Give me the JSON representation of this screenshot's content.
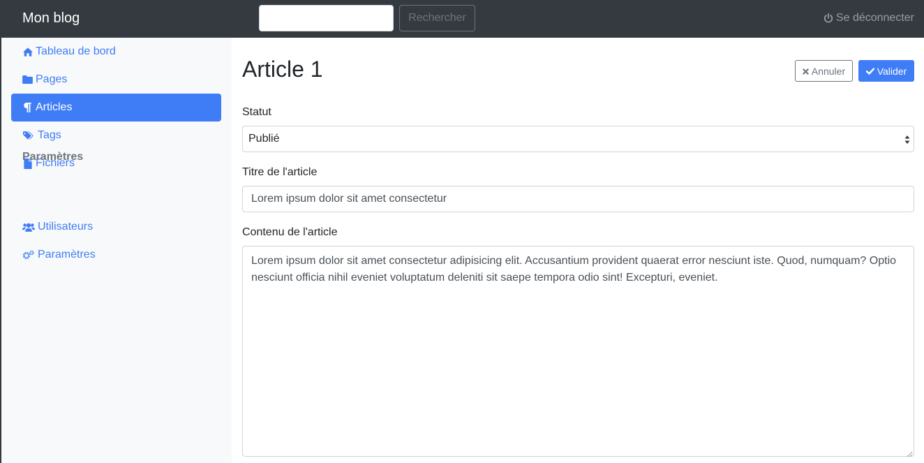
{
  "navbar": {
    "brand": "Mon blog",
    "search_placeholder": "",
    "search_button": "Rechercher",
    "logout_label": "Se déconnecter"
  },
  "sidebar": {
    "items": [
      {
        "label": "Tableau de bord",
        "icon": "home-icon"
      },
      {
        "label": "Pages",
        "icon": "folder-icon"
      },
      {
        "label": "Articles",
        "icon": "paragraph-icon",
        "active": true
      },
      {
        "label": "Tags",
        "icon": "tags-icon"
      },
      {
        "label": "Fichiers",
        "icon": "file-icon"
      }
    ],
    "section_heading": "Paramètres",
    "settings_items": [
      {
        "label": "Utilisateurs",
        "icon": "users-icon"
      },
      {
        "label": "Paramètres",
        "icon": "cogs-icon"
      }
    ]
  },
  "main": {
    "title": "Article 1",
    "cancel_label": "Annuler",
    "validate_label": "Valider",
    "status": {
      "label": "Statut",
      "value": "Publié"
    },
    "article_title": {
      "label": "Titre de l'article",
      "value": "Lorem ipsum dolor sit amet consectetur"
    },
    "article_content": {
      "label": "Contenu de l'article",
      "value": "Lorem ipsum dolor sit amet consectetur adipisicing elit. Accusantium provident quaerat error nesciunt iste. Quod, numquam? Optio nesciunt officia nihil eveniet voluptatum deleniti sit saepe tempora odio sint! Excepturi, eveniet."
    }
  },
  "colors": {
    "navbar_bg": "#343a40",
    "accent": "#3f7df6",
    "sidebar_bg": "#f8f9fa",
    "muted": "#6c757d"
  }
}
